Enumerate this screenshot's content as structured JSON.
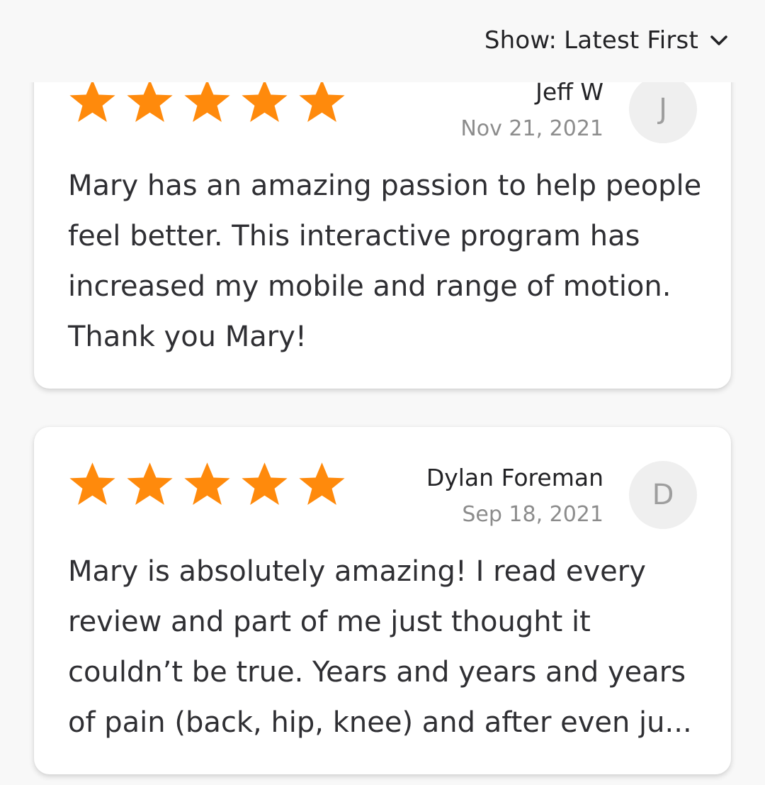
{
  "sort": {
    "prefix": "Show:",
    "value": "Latest First",
    "icon": "chevron-down-icon"
  },
  "colors": {
    "star": "#ff8a0c",
    "background": "#f8f8f8",
    "card": "#ffffff",
    "avatar_bg": "#efefef"
  },
  "reviews": [
    {
      "rating": 5,
      "name": "Jeff W",
      "date": "Nov 21, 2021",
      "initial": "J",
      "text": "Mary has an amazing passion to help people feel better. This interactive program has increased my mobile and range of motion. Thank you Mary!"
    },
    {
      "rating": 5,
      "name": "Dylan Foreman",
      "date": "Sep 18, 2021",
      "initial": "D",
      "text": "Mary is absolutely amazing! I read every review and part of me just thought it couldn’t be true. Years and years and years of pain (back, hip, knee) and after even ju..."
    }
  ]
}
